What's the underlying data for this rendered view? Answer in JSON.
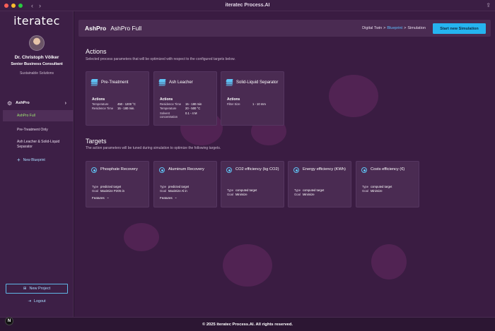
{
  "window": {
    "title": "iteratec Process.AI"
  },
  "brand": {
    "logo": "iteratec"
  },
  "user": {
    "name": "Dr. Christoph Völker",
    "role": "Senior Business Consultant",
    "department": "Sustainable Solutions"
  },
  "sidebar": {
    "section": "AshPro",
    "items": [
      {
        "label": "AshPro Full",
        "active": true
      },
      {
        "label": "Pre-Treatment Only",
        "active": false
      },
      {
        "label": "Ash Leacher & Solid-Liquid Separator",
        "active": false
      }
    ],
    "new_blueprint": "New Blueprint",
    "new_project": "New Project",
    "logout": "Logout"
  },
  "header": {
    "app": "AshPro",
    "blueprint": "AshPro Full",
    "breadcrumb": [
      "Digital Twin",
      ">",
      "Blueprint",
      ">",
      "Simulation"
    ],
    "primary_button": "Start new Simulation"
  },
  "actions": {
    "title": "Actions",
    "subtitle": "Selected process parameters that will be optimized with respect to the configured targets below.",
    "cards": [
      {
        "name": "Pre-Treatment",
        "label": "Actions",
        "params": [
          {
            "k": "Temperature",
            "v": "450 - 1200 °C"
          },
          {
            "k": "Residence Time",
            "v": "15 - 180 min."
          }
        ]
      },
      {
        "name": "Ash Leacher",
        "label": "Actions",
        "params": [
          {
            "k": "Residence Time",
            "v": "15 - 180 min"
          },
          {
            "k": "Temperature",
            "v": "20 - 500 °C"
          },
          {
            "k": "Solvent concentration",
            "v": "0.1 - 4 M"
          }
        ]
      },
      {
        "name": "Solid-Liquid Separator",
        "label": "Actions",
        "params": [
          {
            "k": "Filter Size",
            "v": "1 - 10 mm"
          }
        ]
      }
    ]
  },
  "targets": {
    "title": "Targets",
    "subtitle": "The action parameters will be tuned during simulation to optimize the following targets.",
    "type_label": "Type",
    "goal_label": "Goal",
    "features_label": "Features",
    "cards": [
      {
        "name": "Phosphate Recovery",
        "type": "predicted target",
        "goal": "Maximize P2O5 in",
        "features": true
      },
      {
        "name": "Aluminum Recovery",
        "type": "predicted target",
        "goal": "Maximize Al in",
        "features": true
      },
      {
        "name": "CO2 efficiency (kg CO2)",
        "type": "computed target",
        "goal": "Minimize",
        "features": false
      },
      {
        "name": "Energy efficiency (KWh)",
        "type": "computed target",
        "goal": "Minimize",
        "features": false
      },
      {
        "name": "Costs efficiency (€)",
        "type": "computed target",
        "goal": "Minimize",
        "features": false
      }
    ]
  },
  "footer": {
    "text": "© 2025 iteratec Process.AI. All rights reserved."
  },
  "badge": {
    "letter": "N"
  },
  "colors": {
    "accent": "#25b4f0",
    "active_nav": "#9fe870",
    "panel": "#4a2b52",
    "background": "#3a1c42"
  }
}
